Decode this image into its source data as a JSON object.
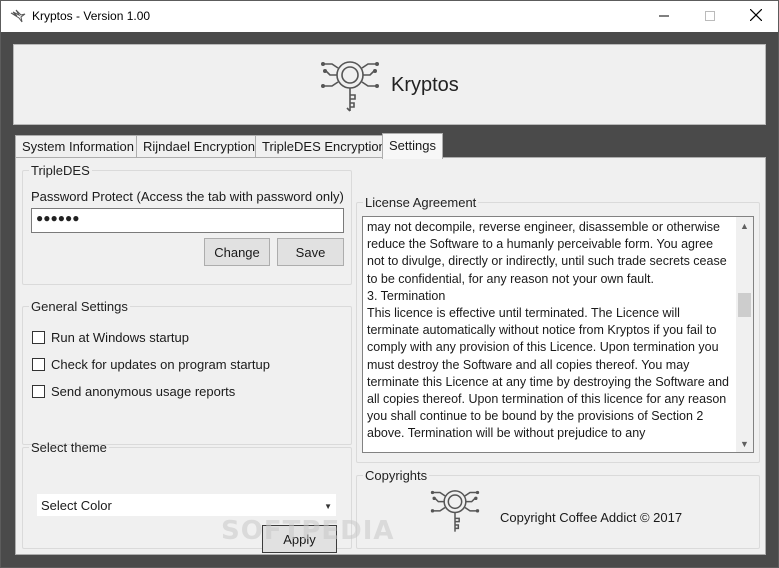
{
  "window": {
    "title": "Kryptos - Version 1.00",
    "icons": {
      "app": "winged-logo-icon",
      "minimize": "minimize-icon",
      "maximize": "maximize-icon",
      "close": "close-icon"
    }
  },
  "header": {
    "brand": "Kryptos",
    "logo_icon": "circuit-key-icon"
  },
  "tabs": [
    {
      "label": "System Information"
    },
    {
      "label": "Rijndael Encryption"
    },
    {
      "label": "TripleDES Encryption"
    },
    {
      "label": "Settings"
    }
  ],
  "tripledes": {
    "group_title": "TripleDES",
    "password_label": "Password Protect (Access the tab with password only)",
    "password_value": "●●●●●●",
    "change_label": "Change",
    "save_label": "Save"
  },
  "general": {
    "group_title": "General Settings",
    "options": [
      {
        "label": "Run at Windows startup",
        "checked": false
      },
      {
        "label": "Check for updates on program startup",
        "checked": false
      },
      {
        "label": "Send anonymous usage reports",
        "checked": false
      }
    ]
  },
  "theme": {
    "group_title": "Select theme",
    "selected": "Select Color",
    "apply_label": "Apply"
  },
  "license": {
    "group_title": "License Agreement",
    "text": "may not decompile, reverse engineer, disassemble or otherwise reduce the Software to a humanly perceivable form. You agree not to divulge, directly or indirectly, until such trade secrets cease to be confidential, for any reason not your own fault.\n3. Termination\nThis licence is effective until terminated. The Licence will terminate automatically without notice from Kryptos if you fail to comply with any provision of this Licence. Upon termination you must destroy the Software and all copies thereof. You may terminate this Licence at any time by destroying the Software and all copies thereof. Upon termination of this licence for any reason you shall continue to be bound by the provisions of Section 2 above. Termination will be without prejudice to any"
  },
  "copyrights": {
    "group_title": "Copyrights",
    "text": "Copyright Coffee Addict ©  2017"
  },
  "watermark": "SOFTPEDIA"
}
